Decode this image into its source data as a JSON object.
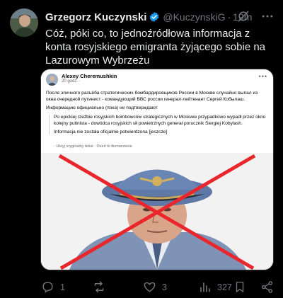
{
  "author": {
    "name": "Grzegorz Kuczynski",
    "handle": "@KuczynskiG",
    "separator": "·",
    "time": "19m"
  },
  "tweet": {
    "text": "Cóż, póki co, to jednoźródłowa informacja z konta rosyjskiego emigranta żyjącego sobie na Lazurowym Wybrzeżu"
  },
  "embedded_post": {
    "author": "Alexey Cheremushkin",
    "time": "20 godz. ·",
    "original_text": "После эпичного разъёба стратегических бомбардировщиков России в Москве случайно выпал из окна очередной путинист - командующий ВВС россии генерал-лейтенант Сергей Кобылаш.",
    "original_note": "Информацию официально (пока) не подтверждают",
    "translated_text": "Po epickiej rzeźbie rosyjskich bombowców strategicznych w Moskwie przypadkowo wypadł przez okno kolejny putinista - dowódca rosyjskich sił powietrznych generał porucznik Siergiej Kobylash.",
    "translated_note": "Informacja nie została oficjalnie potwierdzona [jeszcze]",
    "links": "· Ukryj oryginalny tekst · Oceń to tłumaczenie"
  },
  "actions": {
    "replies": "1",
    "retweets": "",
    "likes": "3",
    "views": "327"
  },
  "colors": {
    "background": "#000000",
    "text": "#e7e9ea",
    "muted": "#71767b",
    "verified": "#1d9bf0",
    "cross": "#e8262b"
  },
  "icons": [
    "verified-badge-icon",
    "slash-icon",
    "more-icon",
    "reply-icon",
    "retweet-icon",
    "like-icon",
    "views-icon",
    "share-icon"
  ]
}
